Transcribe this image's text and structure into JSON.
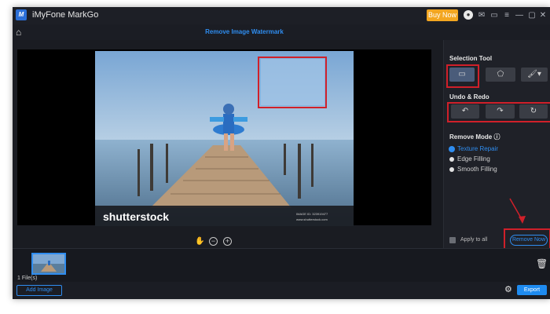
{
  "titlebar": {
    "app_title": "iMyFone MarkGo",
    "logo_text": "M",
    "buy_now_label": "Buy Now",
    "icons": [
      "user-icon",
      "mail-icon",
      "chat-icon",
      "menu-icon",
      "minimize-icon",
      "maximize-icon",
      "close-icon"
    ]
  },
  "header": {
    "title": "Remove Image Watermark"
  },
  "canvas": {
    "watermark_brand": "shutterstock",
    "watermark_id_line1": "IMAGE ID: 323919477",
    "watermark_id_line2": "www.shutterstock.com",
    "tools": [
      "hand-icon",
      "zoom-out-icon",
      "zoom-in-icon"
    ]
  },
  "right_panel": {
    "selection_tool_label": "Selection Tool",
    "undo_redo_label": "Undo & Redo",
    "remove_mode_label": "Remove Mode",
    "modes": [
      {
        "label": "Texture Repair",
        "selected": true
      },
      {
        "label": "Edge Filling",
        "selected": false
      },
      {
        "label": "Smooth Filling",
        "selected": false
      }
    ],
    "apply_to_all_label": "Apply to all",
    "remove_now_label": "Remove Now"
  },
  "filmstrip": {
    "files_count": "1 File(s)"
  },
  "footer": {
    "add_image_label": "Add Image",
    "export_label": "Export"
  },
  "colors": {
    "accent": "#2f8df0",
    "buy": "#f3a620",
    "highlight_red": "#d0202a"
  }
}
